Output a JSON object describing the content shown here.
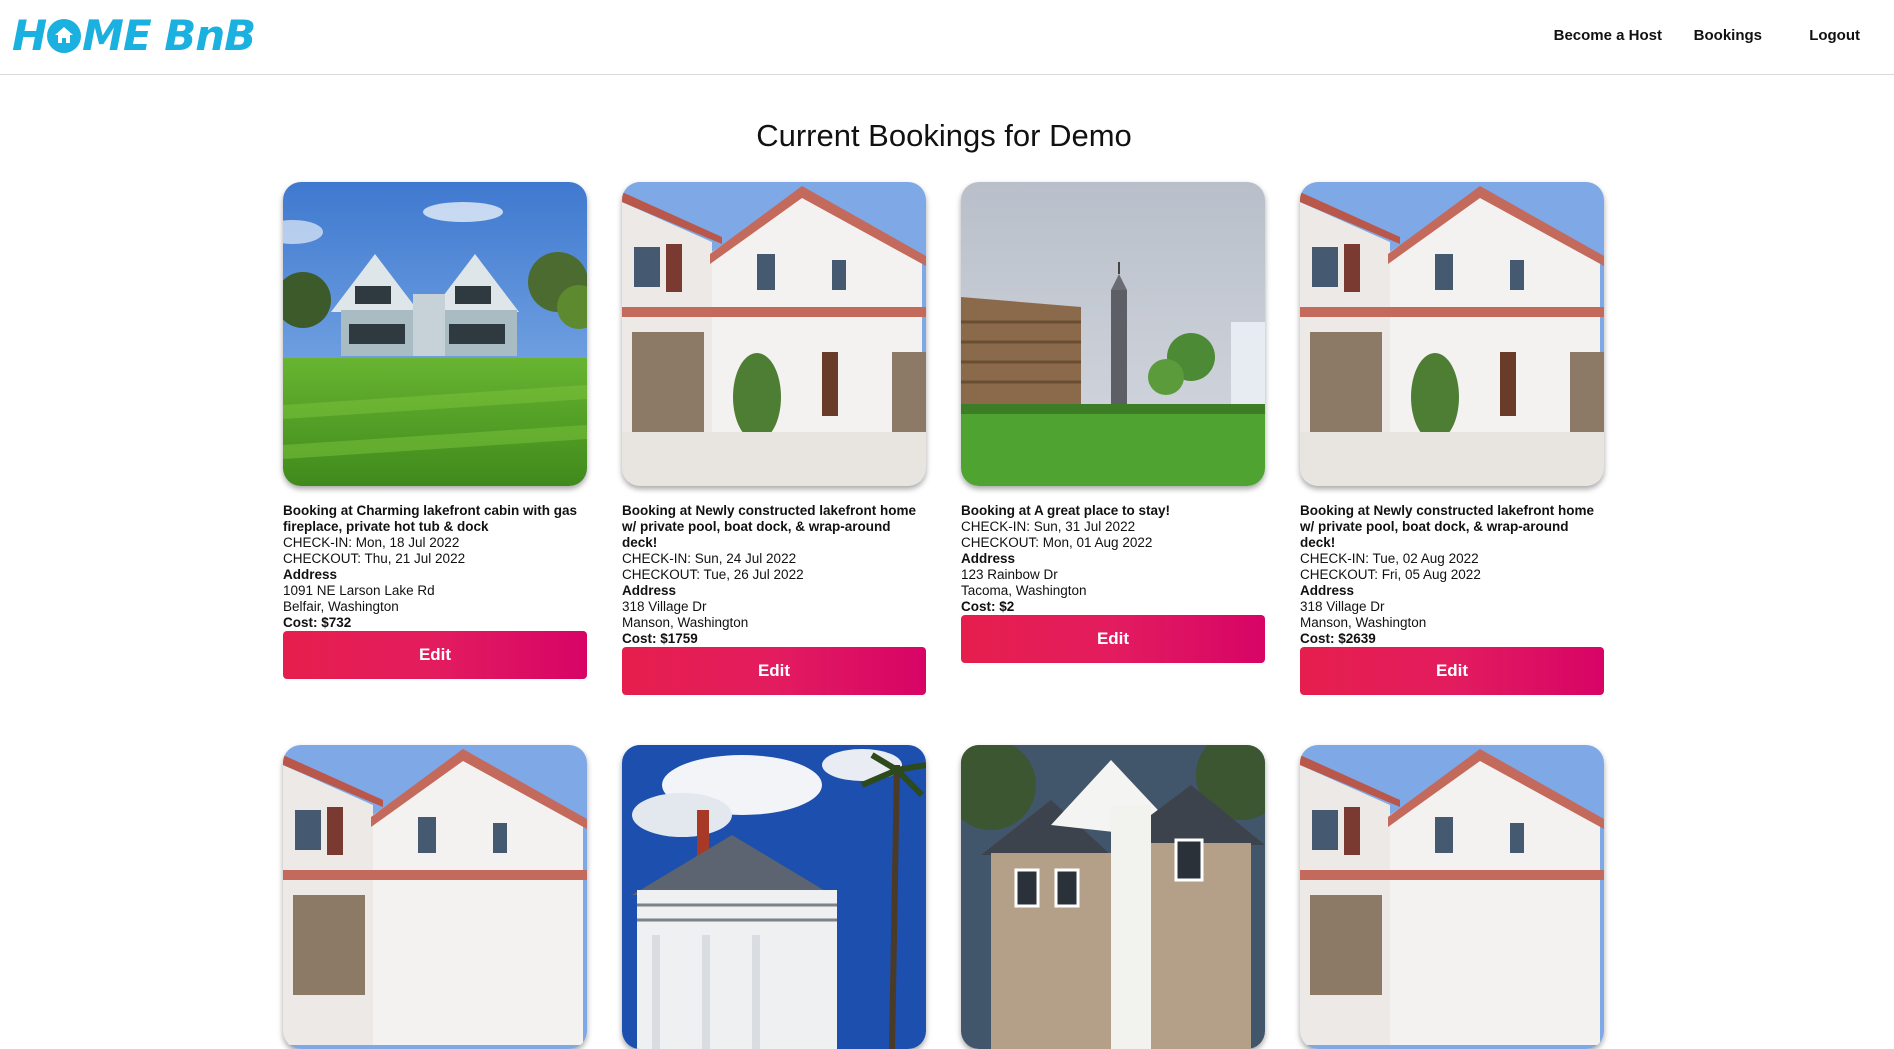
{
  "app": {
    "logo_text_a": "H",
    "logo_text_b": "ME BnB",
    "nav": {
      "become_host": "Become a Host",
      "bookings": "Bookings",
      "logout": "Logout"
    }
  },
  "page": {
    "title": "Current Bookings for Demo"
  },
  "labels": {
    "address": "Address",
    "edit": "Edit"
  },
  "colors": {
    "brand": "#1ab0df",
    "button_start": "#e61e4d",
    "button_end": "#d70466"
  },
  "bookings": [
    {
      "photo": "white-cabin-lawn",
      "title": "Booking at Charming lakefront cabin with gas fireplace, private hot tub & dock",
      "checkin": "CHECK-IN: Mon, 18 Jul 2022",
      "checkout": "CHECKOUT: Thu, 21 Jul 2022",
      "street": "1091 NE Larson Lake Rd",
      "city": "Belfair, Washington",
      "cost": "Cost: $732"
    },
    {
      "photo": "stucco-villa",
      "title": "Booking at Newly constructed lakefront home w/ private pool, boat dock, & wrap-around deck!",
      "checkin": "CHECK-IN: Sun, 24 Jul 2022",
      "checkout": "CHECKOUT: Tue, 26 Jul 2022",
      "street": "318 Village Dr",
      "city": "Manson, Washington",
      "cost": "Cost: $1759"
    },
    {
      "photo": "city-park-tower",
      "title": "Booking at A great place to stay!",
      "checkin": "CHECK-IN: Sun, 31 Jul 2022",
      "checkout": "CHECKOUT: Mon, 01 Aug 2022",
      "street": "123 Rainbow Dr",
      "city": "Tacoma, Washington",
      "cost": "Cost: $2"
    },
    {
      "photo": "stucco-villa",
      "title": "Booking at Newly constructed lakefront home w/ private pool, boat dock, & wrap-around deck!",
      "checkin": "CHECK-IN: Tue, 02 Aug 2022",
      "checkout": "CHECKOUT: Fri, 05 Aug 2022",
      "street": "318 Village Dr",
      "city": "Manson, Washington",
      "cost": "Cost: $2639"
    },
    {
      "photo": "stucco-villa"
    },
    {
      "photo": "victorian-mansion"
    },
    {
      "photo": "suburban-house"
    },
    {
      "photo": "stucco-villa"
    }
  ]
}
